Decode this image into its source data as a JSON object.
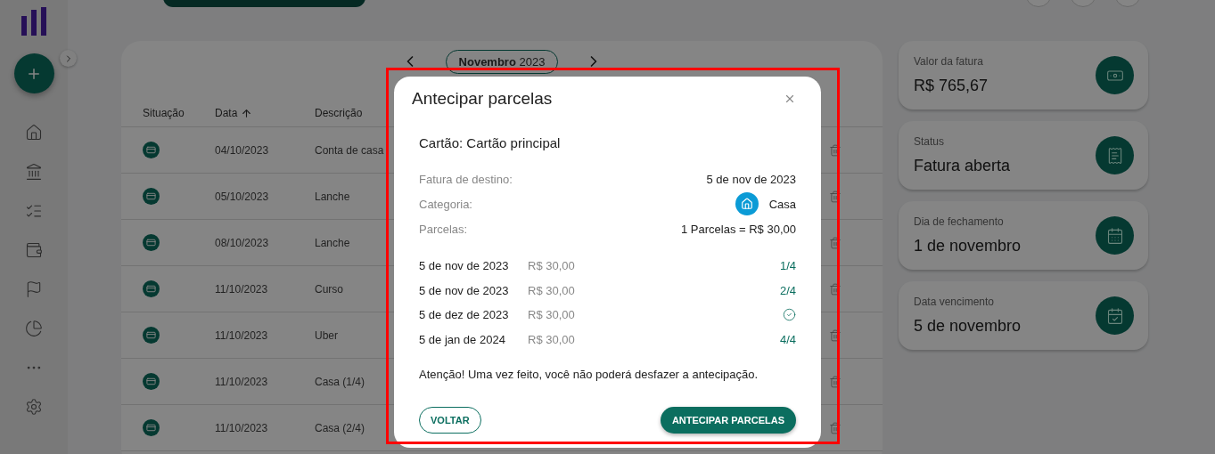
{
  "month_nav": {
    "label": "**Novembro** 2023"
  },
  "table": {
    "columns": [
      {
        "label": "Situação",
        "sorted": false
      },
      {
        "label": "Data",
        "sorted": true
      },
      {
        "label": "Descrição",
        "sorted": false
      }
    ],
    "rows": [
      {
        "date": "04/10/2023",
        "description": "Conta de casa"
      },
      {
        "date": "05/10/2023",
        "description": "Lanche"
      },
      {
        "date": "08/10/2023",
        "description": "Lanche"
      },
      {
        "date": "11/10/2023",
        "description": "Curso"
      },
      {
        "date": "11/10/2023",
        "description": "Uber"
      },
      {
        "date": "11/10/2023",
        "description": "Casa (1/4)"
      },
      {
        "date": "11/10/2023",
        "description": "Casa (2/4)"
      }
    ]
  },
  "summary_cards": [
    {
      "kind": "amount",
      "label": "Valor da fatura",
      "value": "R$ 765,67"
    },
    {
      "kind": "status",
      "label": "Status",
      "value": "Fatura aberta"
    },
    {
      "kind": "closing",
      "label": "Dia de fechamento",
      "value": "1 de novembro"
    },
    {
      "kind": "due",
      "label": "Data vencimento",
      "value": "5 de novembro"
    }
  ],
  "modal": {
    "title": "Antecipar parcelas",
    "card_line": "Cartão: Cartão principal",
    "details": [
      {
        "kind": "text",
        "label": "Fatura de destino:",
        "value": "5 de nov de 2023"
      },
      {
        "kind": "category",
        "label": "Categoria:",
        "value": "Casa"
      },
      {
        "kind": "text",
        "label": "Parcelas:",
        "value": "1 Parcelas = R$ 30,00"
      }
    ],
    "installments": [
      {
        "kind": "fraction",
        "date": "5 de nov de 2023",
        "amount": "R$ 30,00",
        "status": "1/4"
      },
      {
        "kind": "fraction",
        "date": "5 de nov de 2023",
        "amount": "R$ 30,00",
        "status": "2/4"
      },
      {
        "kind": "paid",
        "date": "5 de dez de 2023",
        "amount": "R$ 30,00"
      },
      {
        "kind": "fraction",
        "date": "5 de jan de 2024",
        "amount": "R$ 30,00",
        "status": "4/4"
      }
    ],
    "warning": "Atenção! Uma vez feito, você não poderá desfazer a antecipação.",
    "secondary_button": "VOLTAR",
    "primary_button": "ANTECIPAR PARCELAS"
  }
}
